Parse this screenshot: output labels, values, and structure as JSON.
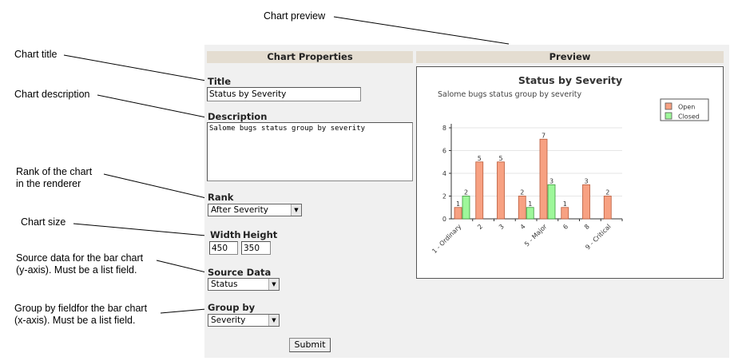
{
  "annotations": {
    "chart_preview": "Chart preview",
    "chart_title": "Chart title",
    "chart_description": "Chart description",
    "rank_line1": "Rank of the chart",
    "rank_line2": "in the renderer",
    "chart_size": "Chart size",
    "source_line1": "Source data for the bar chart",
    "source_line2": "(y-axis). Must be a list field.",
    "groupby_line1": "Group by fieldfor the bar chart",
    "groupby_line2": "(x-axis). Must be a list field."
  },
  "form": {
    "section_header": "Chart Properties",
    "title_label": "Title",
    "title_value": "Status by Severity",
    "description_label": "Description",
    "description_value": "Salome bugs status group by severity",
    "rank_label": "Rank",
    "rank_value": "After Severity",
    "width_label": "Width",
    "height_label": "Height",
    "width_value": "450",
    "height_value": "350",
    "source_label": "Source Data",
    "source_value": "Status",
    "groupby_label": "Group by",
    "groupby_value": "Severity",
    "submit_label": "Submit"
  },
  "preview": {
    "section_header": "Preview"
  },
  "chart_data": {
    "type": "bar",
    "title": "Status by Severity",
    "subtitle": "Salome bugs status group by severity",
    "categories": [
      "1 - Ordinary",
      "2",
      "3",
      "4",
      "5 - Major",
      "6",
      "8",
      "9 - Critical"
    ],
    "series": [
      {
        "name": "Open",
        "values": [
          1,
          5,
          5,
          2,
          7,
          1,
          3,
          2
        ],
        "color": "#f7a182"
      },
      {
        "name": "Closed",
        "values": [
          2,
          null,
          null,
          1,
          3,
          null,
          null,
          null
        ],
        "color": "#9ef79a"
      }
    ],
    "yticks": [
      0,
      2,
      4,
      6,
      8
    ],
    "ylim": [
      0,
      8
    ],
    "legend": "top-right",
    "grid": true,
    "data_labels": true
  }
}
